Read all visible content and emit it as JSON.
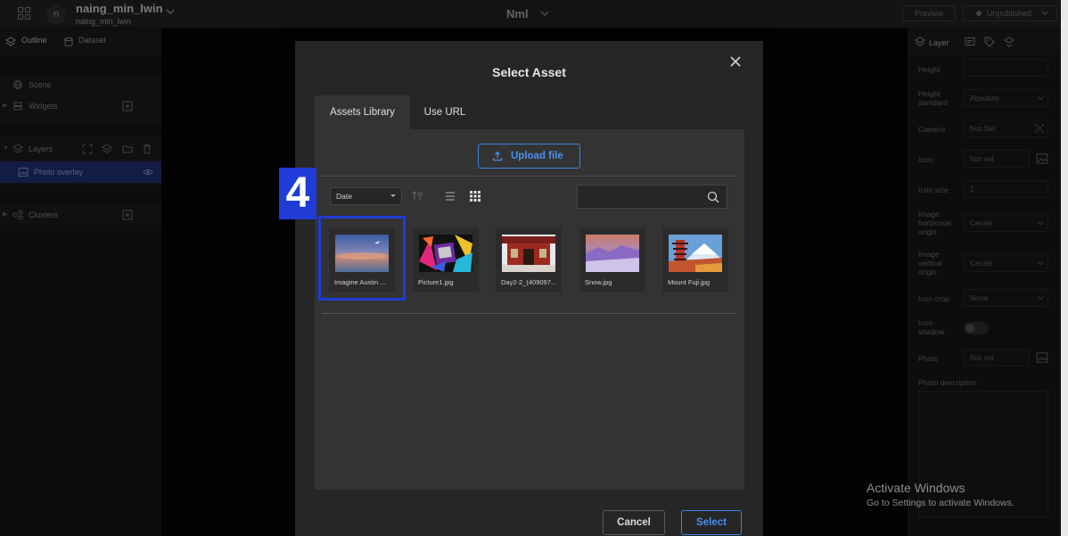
{
  "header": {
    "workspace_name": "naing_min_lwin",
    "workspace_sub": "naing_min_lwin",
    "avatar_letter": "n",
    "project_name": "Nml",
    "preview_label": "Preview",
    "publish_label": "Unpublished"
  },
  "left_panel": {
    "tabs": [
      {
        "label": "Outline"
      },
      {
        "label": "Dataset"
      }
    ],
    "rows": {
      "scene": "Scene",
      "widgets": "Widgets",
      "layers": "Layers",
      "photo_overlay": "Photo overlay",
      "clusters": "Clusters"
    }
  },
  "right_panel": {
    "tab_label": "Layer",
    "fields": {
      "height": "Height",
      "height_standard": "Height standard",
      "height_standard_value": "Absolute",
      "camera": "Camera",
      "camera_value": "Not Set",
      "icon": "Icon",
      "icon_value": "Not set",
      "icon_size": "Icon size",
      "icon_size_value": "1",
      "image_h_origin": "Image horizontal origin",
      "image_h_origin_value": "Center",
      "image_v_origin": "Image vertical origin",
      "image_v_origin_value": "Center",
      "icon_crop": "Icon crop",
      "icon_crop_value": "None",
      "icon_shadow": "Icon shadow",
      "photo": "Photo",
      "photo_value": "Not set",
      "photo_description": "Photo description"
    }
  },
  "modal": {
    "title": "Select Asset",
    "tabs": {
      "library": "Assets Library",
      "url": "Use URL"
    },
    "upload_label": "Upload file",
    "sort_value": "Date",
    "search_placeholder": "",
    "assets": [
      {
        "name": "Imagine Austin ..."
      },
      {
        "name": "Picture1.jpg"
      },
      {
        "name": "Day2-2_(409097..."
      },
      {
        "name": "Snow.jpg"
      },
      {
        "name": "Mount Fuji.jpg"
      }
    ],
    "cancel_label": "Cancel",
    "select_label": "Select"
  },
  "annotation": {
    "step": "4"
  },
  "watermark": {
    "line1": "Activate Windows",
    "line2": "Go to Settings to activate Windows."
  },
  "colors": {
    "accent": "#3b82e8",
    "selection": "#1f3cd6",
    "modal_bg": "#262626",
    "content_bg": "#333333"
  }
}
